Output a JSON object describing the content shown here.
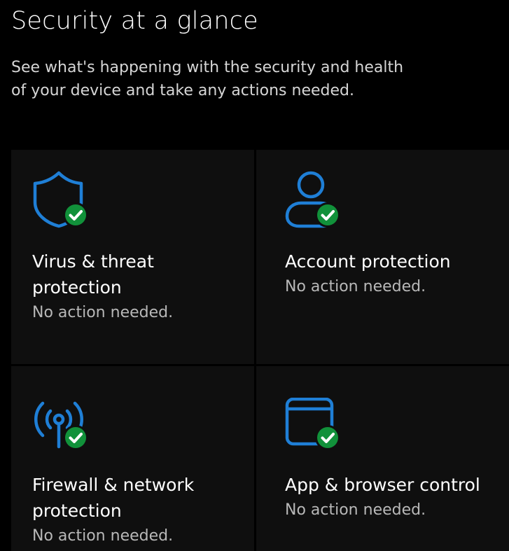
{
  "page": {
    "title": "Security at a glance",
    "subtitle_line1": "See what's happening with the security and health",
    "subtitle_line2": "of your device and take any actions needed."
  },
  "colors": {
    "background": "#000000",
    "tile": "#0f0f0f",
    "icon_blue": "#1f7fd6",
    "check_green": "#11913a"
  },
  "tiles": [
    {
      "icon": "shield-icon",
      "title_line1": "Virus & threat",
      "title_line2": "protection",
      "status": "No action needed."
    },
    {
      "icon": "person-icon",
      "title_line1": "Account protection",
      "title_line2": "",
      "status": "No action needed."
    },
    {
      "icon": "antenna-icon",
      "title_line1": "Firewall & network",
      "title_line2": "protection",
      "status": "No action needed."
    },
    {
      "icon": "browser-window-icon",
      "title_line1": "App & browser control",
      "title_line2": "",
      "status": "No action needed."
    }
  ]
}
